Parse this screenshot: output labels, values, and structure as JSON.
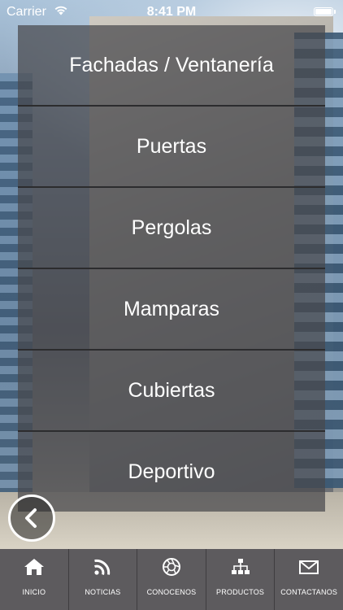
{
  "status_bar": {
    "carrier": "Carrier",
    "time": "8:41 PM",
    "battery_level": 1.0
  },
  "menu": {
    "items": [
      {
        "label": "Fachadas / Ventanería"
      },
      {
        "label": "Puertas"
      },
      {
        "label": "Pergolas"
      },
      {
        "label": "Mamparas"
      },
      {
        "label": "Cubiertas"
      },
      {
        "label": "Deportivo"
      }
    ]
  },
  "back_button": {
    "icon": "chevron-left-icon"
  },
  "tab_bar": {
    "tabs": [
      {
        "label": "INICIO",
        "icon": "home-icon"
      },
      {
        "label": "NOTICIAS",
        "icon": "rss-icon"
      },
      {
        "label": "CONOCENOS",
        "icon": "aperture-icon"
      },
      {
        "label": "PRODUCTOS",
        "icon": "sitemap-icon"
      },
      {
        "label": "CONTACTANOS",
        "icon": "mail-icon"
      }
    ]
  },
  "colors": {
    "menu_background": "#48484c",
    "menu_divider": "#2c2c2e",
    "tab_bar_background": "#5d5b5e",
    "text": "#ffffff"
  }
}
